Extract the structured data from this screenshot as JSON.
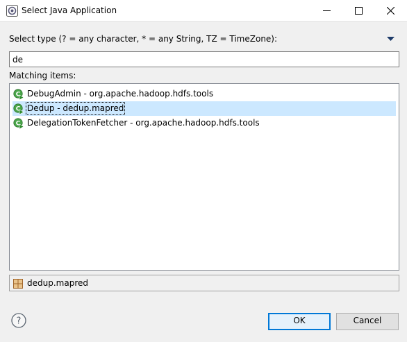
{
  "window": {
    "title": "Select Java Application",
    "controls": [
      "minimize-icon",
      "maximize-icon",
      "close-icon"
    ]
  },
  "filter": {
    "label": "Select type (? = any character, * = any String, TZ = TimeZone):",
    "value": "de"
  },
  "matching_label": "Matching items:",
  "items": [
    {
      "label": "DebugAdmin - org.apache.hadoop.hdfs.tools",
      "selected": false,
      "icon": "java-class-run-icon"
    },
    {
      "label": "Dedup - dedup.mapred",
      "selected": true,
      "icon": "java-class-run-icon"
    },
    {
      "label": "DelegationTokenFetcher - org.apache.hadoop.hdfs.tools",
      "selected": false,
      "icon": "java-class-run-icon"
    }
  ],
  "package": {
    "label": "dedup.mapred",
    "icon": "package-icon"
  },
  "buttons": {
    "ok": "OK",
    "cancel": "Cancel"
  },
  "colors": {
    "selection": "#cce8ff",
    "default_button_border": "#0078d7",
    "class_icon": "#3c9a3c"
  }
}
